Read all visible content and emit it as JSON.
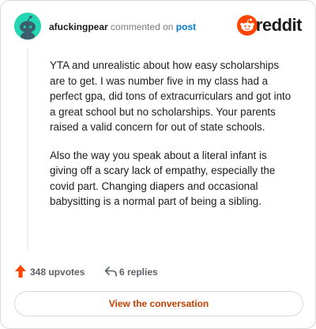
{
  "header": {
    "username": "afuckingpear",
    "action_text": "commented on",
    "post_link": "post",
    "brand": "reddit"
  },
  "comment": {
    "paragraphs": [
      "YTA and unrealistic about how easy scholarships are to get. I was number five in my class had a perfect gpa, did tons of extracurriculars and got into a great school but no scholarships. Your parents raised a valid concern for out of state schools.",
      "Also the way you speak about a literal infant is giving off a scary lack of empathy, especially the covid part. Changing diapers and occasional babysitting is a normal part of being a sibling."
    ]
  },
  "actions": {
    "upvotes": "348 upvotes",
    "replies": "6 replies"
  },
  "cta": {
    "label": "View the conversation"
  },
  "colors": {
    "accent": "#ff4500",
    "link": "#0079d3",
    "cta_text": "#c33f00",
    "avatar_bg": "#24d6b2"
  },
  "icons": {
    "avatar": "snoo-avatar-icon",
    "brand": "reddit-logo-icon",
    "upvote": "upvote-arrow-icon",
    "reply": "reply-arrow-icon"
  }
}
